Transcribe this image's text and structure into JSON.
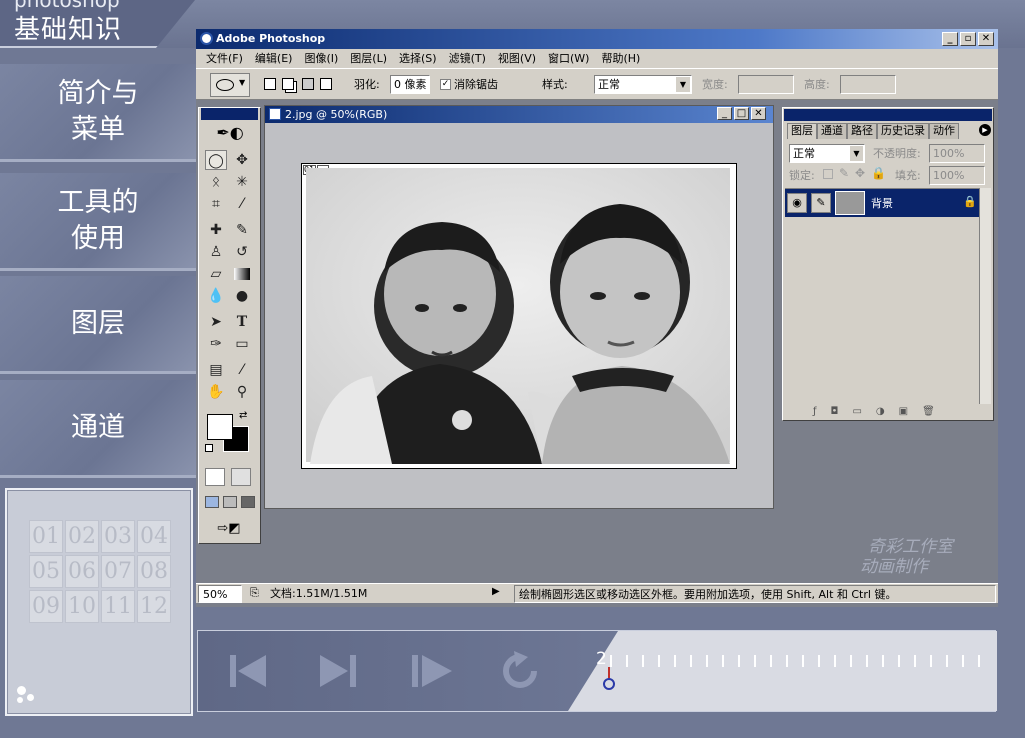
{
  "course": {
    "top_title": "photoshop",
    "main_title": "基础知识"
  },
  "nav": [
    {
      "label": "简介与\n菜单"
    },
    {
      "label": "工具的\n使用"
    },
    {
      "label": "图层"
    },
    {
      "label": "通道"
    }
  ],
  "lesson_grid": [
    "01",
    "02",
    "03",
    "04",
    "05",
    "06",
    "07",
    "08",
    "09",
    "10",
    "11",
    "12"
  ],
  "photoshop": {
    "title": "Adobe Photoshop",
    "menus": [
      "文件(F)",
      "编辑(E)",
      "图像(I)",
      "图层(L)",
      "选择(S)",
      "滤镜(T)",
      "视图(V)",
      "窗口(W)",
      "帮助(H)"
    ],
    "options": {
      "feather_label": "羽化:",
      "feather_value": "0 像素",
      "antialias_label": "消除锯齿",
      "style_label": "样式:",
      "style_value": "正常",
      "width_label": "宽度:",
      "height_label": "高度:"
    },
    "document": {
      "title": "2.jpg @ 50%(RGB)",
      "canvas_tag": "01"
    },
    "layers_palette": {
      "tabs": [
        "图层",
        "通道",
        "路径",
        "历史记录",
        "动作"
      ],
      "blend_mode": "正常",
      "opacity_label": "不透明度:",
      "opacity_value": "100%",
      "lock_label": "锁定:",
      "fill_label": "填充:",
      "fill_value": "100%",
      "layer_name": "背景"
    },
    "status": {
      "zoom": "50%",
      "doc_size": "文档:1.51M/1.51M",
      "hint": "绘制椭圆形选区或移动选区外框。要用附加选项，使用 Shift, Alt 和 Ctrl 键。"
    }
  },
  "watermark": [
    "奇彩工作室",
    "动画制作"
  ],
  "player": {
    "timeline_marker": "2"
  },
  "colors": {
    "frame": "#6f7894",
    "ps_gray": "#d4d0c8",
    "title_blue": "#0b2a6e",
    "selected_layer": "#0a246a"
  }
}
